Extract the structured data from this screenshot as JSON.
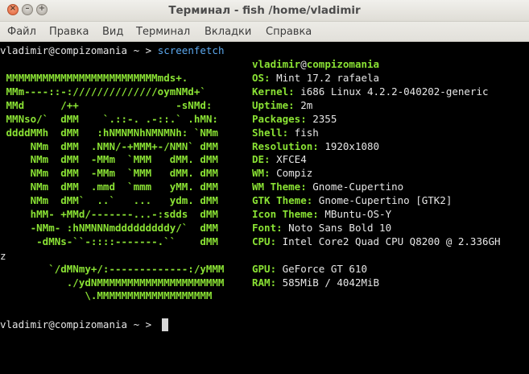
{
  "window": {
    "title": "Терминал - fish  /home/vladimir"
  },
  "menubar": {
    "items": [
      "Файл",
      "Правка",
      "Вид",
      "Терминал",
      "Вкладки",
      "Справка"
    ]
  },
  "terminal": {
    "prompt_user": "vladimir@compizomania",
    "prompt_path": "~",
    "prompt_symbol": ">",
    "command": "screenfetch",
    "header_user": "vladimir",
    "header_at": "@",
    "header_host": "compizomania",
    "logo": [
      " MMMMMMMMMMMMMMMMMMMMMMMMMmds+.",
      " MMm----::-://////////////oymNMd+`",
      " MMd      /++                -sNMd:",
      " MMNso/`  dMM    `.::-. .-::.` .hMN:",
      " ddddMMh  dMM   :hNMNMNhNMNMNh: `NMm",
      "     NMm  dMM  .NMN/-+MMM+-/NMN` dMM",
      "     NMm  dMM  -MMm  `MMM   dMM. dMM",
      "     NMm  dMM  -MMm  `MMM   dMM. dMM",
      "     NMm  dMM  .mmd  `mmm   yMM. dMM",
      "     NMm  dMM`  ..`   ...   ydm. dMM",
      "     hMM- +MMd/-------...-:sdds  dMM",
      "     -NMm- :hNMNNNmdddddddddy/`  dMM",
      "      -dMNs-``-::::-------.``    dMM",
      "",
      "        `/dMNmy+/:-------------:/yMMM",
      "           ./ydNMMMMMMMMMMMMMMMMMMMMM",
      "              \\.MMMMMMMMMMMMMMMMMMM"
    ],
    "info": [
      {
        "key": "OS:",
        "value": " Mint 17.2 rafaela"
      },
      {
        "key": "Kernel:",
        "value": " i686 Linux 4.2.2-040202-generic"
      },
      {
        "key": "Uptime:",
        "value": " 2m"
      },
      {
        "key": "Packages:",
        "value": " 2355"
      },
      {
        "key": "Shell:",
        "value": " fish"
      },
      {
        "key": "Resolution:",
        "value": " 1920x1080"
      },
      {
        "key": "DE:",
        "value": " XFCE4"
      },
      {
        "key": "WM:",
        "value": " Compiz"
      },
      {
        "key": "WM Theme:",
        "value": " Gnome-Cupertino"
      },
      {
        "key": "GTK Theme:",
        "value": " Gnome-Cupertino [GTK2]"
      },
      {
        "key": "Icon Theme:",
        "value": " MBuntu-OS-Y"
      },
      {
        "key": "Font:",
        "value": " Noto Sans Bold 10"
      },
      {
        "key": "CPU:",
        "value": " Intel Core2 Quad CPU Q8200 @ 2.336GH"
      },
      {
        "key": "",
        "value": ""
      },
      {
        "key": "GPU:",
        "value": " GeForce GT 610"
      },
      {
        "key": "RAM:",
        "value": " 585MiB / 4042MiB"
      }
    ],
    "wrap_char": "z"
  }
}
